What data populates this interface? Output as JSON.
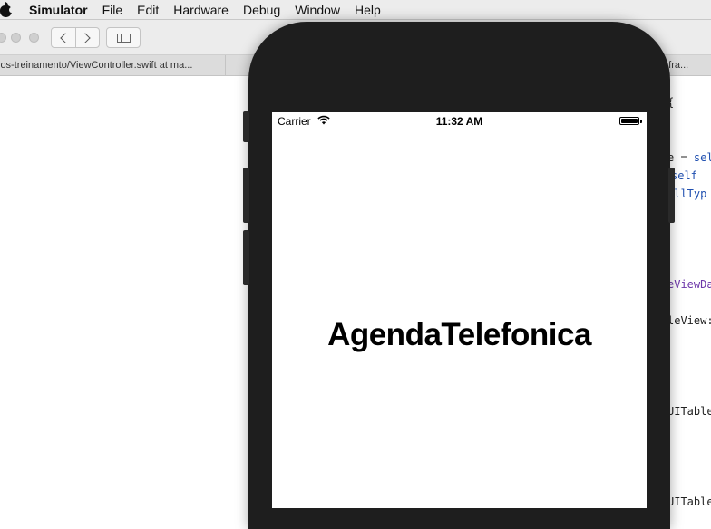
{
  "menubar": {
    "app_name": "Simulator",
    "items": [
      "File",
      "Edit",
      "Hardware",
      "Debug",
      "Window",
      "Help"
    ]
  },
  "xcode": {
    "tab_left": "ios-treinamento/ViewController.swift at ma...",
    "tab_right": "a fra..."
  },
  "code_fragments": {
    "line1_a": "e = ",
    "line1_b": "sel",
    "line2_a": " self",
    "line3_a": "ellTyp",
    "line4_a": "eViewDa",
    "line5_a": "leView:",
    "line6_a": "UITable",
    "line7_a": "UITable"
  },
  "simulator": {
    "carrier": "Carrier",
    "time": "11:32 AM",
    "app_title": "AgendaTelefonica"
  }
}
